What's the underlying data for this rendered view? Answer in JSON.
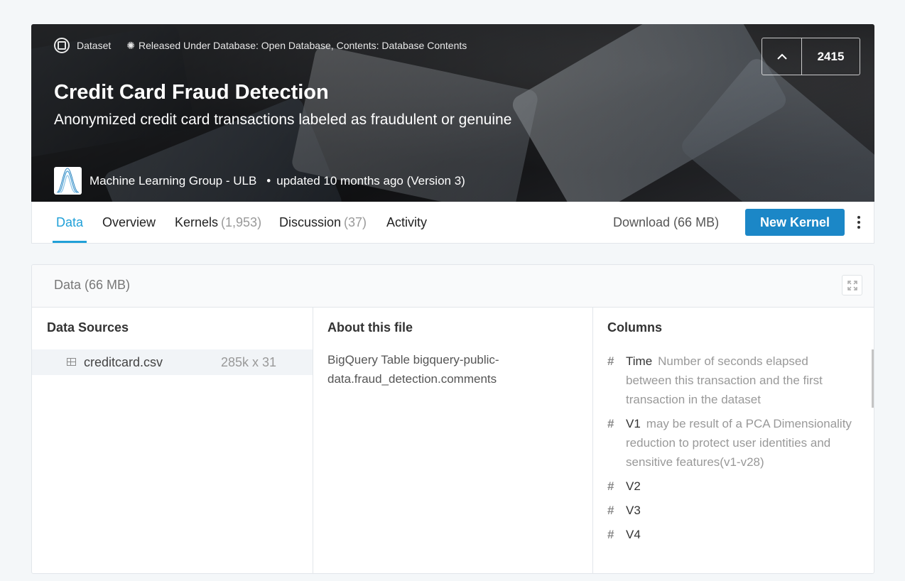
{
  "hero": {
    "type_label": "Dataset",
    "license": "Released Under Database: Open Database, Contents: Database Contents",
    "title": "Credit Card Fraud Detection",
    "subtitle": "Anonymized credit card transactions labeled as fraudulent or genuine",
    "owner": "Machine Learning Group - ULB",
    "updated": "updated 10 months ago (Version 3)",
    "upvote_count": "2415",
    "dot": "•"
  },
  "tabs": [
    {
      "label": "Data",
      "count": ""
    },
    {
      "label": "Overview",
      "count": ""
    },
    {
      "label": "Kernels",
      "count": "(1,953)"
    },
    {
      "label": "Discussion",
      "count": "(37)"
    },
    {
      "label": "Activity",
      "count": ""
    }
  ],
  "actions": {
    "download": "Download (66 MB)",
    "new_kernel": "New Kernel"
  },
  "panel": {
    "title": "Data (66 MB)",
    "sources_title": "Data Sources",
    "about_title": "About this file",
    "columns_title": "Columns",
    "file": {
      "name": "creditcard.csv",
      "size": "285k x 31"
    },
    "about_text": "BigQuery Table bigquery-public-data.fraud_detection.comments",
    "columns": [
      {
        "hash": "#",
        "name": "Time",
        "desc": "Number of seconds elapsed between this transaction and the first transaction in the dataset"
      },
      {
        "hash": "#",
        "name": "V1",
        "desc": "may be result of a PCA Dimensionality reduction to protect user identities and sensitive features(v1-v28)"
      },
      {
        "hash": "#",
        "name": "V2",
        "desc": ""
      },
      {
        "hash": "#",
        "name": "V3",
        "desc": ""
      },
      {
        "hash": "#",
        "name": "V4",
        "desc": ""
      }
    ]
  },
  "icons": {
    "dataset": "dataset-icon",
    "license": "license-badge-icon",
    "upvote": "chevron-up-icon",
    "expand": "expand-icon",
    "file": "table-file-icon",
    "more": "more-vertical-icon"
  },
  "colors": {
    "accent": "#20a0d8",
    "primary_button": "#1b87c7"
  }
}
